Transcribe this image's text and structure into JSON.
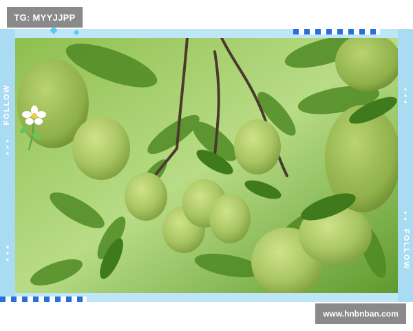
{
  "overlay": {
    "tag_text": "TG: MYYJJPP",
    "url_text": "www.hnbnban.com",
    "follow_left": "FOLLOW",
    "follow_right": "FOLLOW"
  },
  "photo": {
    "subject": "guava-fruits-on-tree",
    "icon": "flower-icon"
  },
  "colors": {
    "frame": "#bfe6f7",
    "checker": "#2a6fd6",
    "label_bg": "#8a8a8a"
  }
}
